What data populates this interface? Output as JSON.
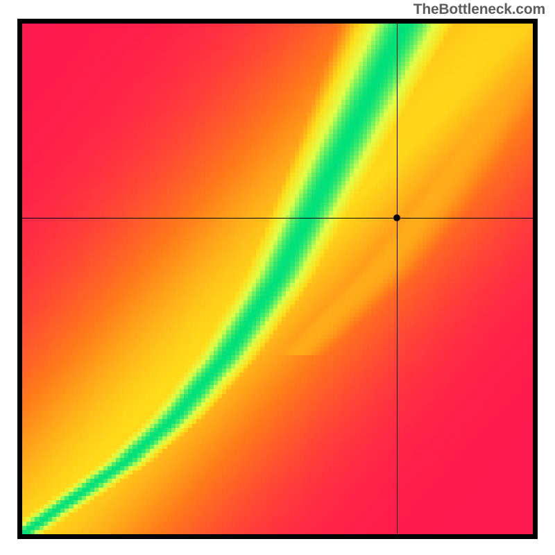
{
  "watermark": "TheBottleneck.com",
  "chart_data": {
    "type": "heatmap",
    "title": "",
    "xlabel": "",
    "ylabel": "",
    "xlim": [
      0,
      1
    ],
    "ylim": [
      0,
      1
    ],
    "grid": false,
    "crosshair": {
      "x": 0.734,
      "y": 0.619
    },
    "marker": {
      "x": 0.734,
      "y": 0.619
    },
    "optimal_curve": {
      "description": "green ridge of optimal pairing through the field",
      "points": [
        {
          "x": 0.0,
          "y": 0.0
        },
        {
          "x": 0.1,
          "y": 0.07
        },
        {
          "x": 0.2,
          "y": 0.14
        },
        {
          "x": 0.3,
          "y": 0.23
        },
        {
          "x": 0.4,
          "y": 0.35
        },
        {
          "x": 0.5,
          "y": 0.5
        },
        {
          "x": 0.55,
          "y": 0.6
        },
        {
          "x": 0.6,
          "y": 0.7
        },
        {
          "x": 0.65,
          "y": 0.8
        },
        {
          "x": 0.7,
          "y": 0.9
        },
        {
          "x": 0.75,
          "y": 1.0
        }
      ]
    },
    "secondary_ridge": {
      "description": "faint yellow ridge on the right",
      "points": [
        {
          "x": 0.6,
          "y": 0.42
        },
        {
          "x": 0.7,
          "y": 0.52
        },
        {
          "x": 0.8,
          "y": 0.65
        },
        {
          "x": 0.9,
          "y": 0.8
        },
        {
          "x": 1.0,
          "y": 0.95
        }
      ]
    },
    "color_stops": [
      {
        "value": 0.0,
        "color": "#ff1a4d"
      },
      {
        "value": 0.3,
        "color": "#ff7a1a"
      },
      {
        "value": 0.55,
        "color": "#ffdc1a"
      },
      {
        "value": 0.78,
        "color": "#e0ff4a"
      },
      {
        "value": 1.0,
        "color": "#00e07a"
      }
    ],
    "resolution": 120
  }
}
